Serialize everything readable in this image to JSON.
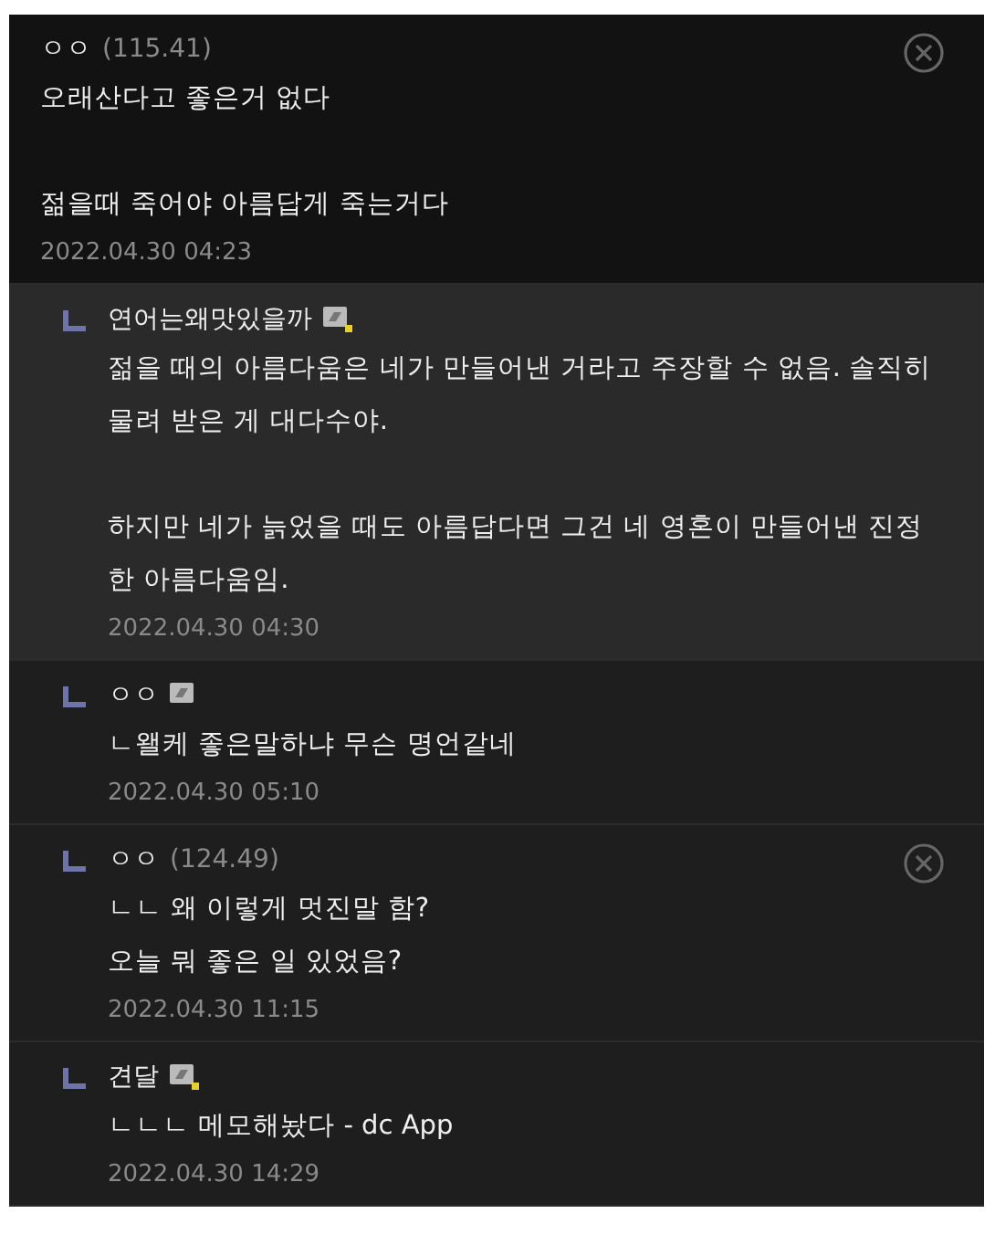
{
  "comments": [
    {
      "kind": "comment",
      "author": "ㅇㅇ",
      "ip": "(115.41)",
      "highlighted": false,
      "deletable": true,
      "text": "오래산다고 좋은거 없다\n\n젊을때 죽어야 아름답게 죽는거다",
      "date": "2022.04.30 04:23"
    },
    {
      "kind": "reply",
      "author": "연어는왜맛있을까",
      "nick_icon": true,
      "fixed_nick": true,
      "highlighted": true,
      "deletable": false,
      "text": "젊을 때의 아름다움은 네가 만들어낸 거라고 주장할 수 없음. 솔직히 물려 받은 게 대다수야.\n\n하지만 네가 늙었을 때도 아름답다면 그건 네 영혼이 만들어낸 진정한 아름다움임.",
      "date": "2022.04.30 04:30"
    },
    {
      "kind": "reply",
      "author": "ㅇㅇ",
      "nick_icon": true,
      "fixed_nick": false,
      "highlighted": false,
      "deletable": false,
      "text": "ㄴ왤케 좋은말하냐 무슨 명언같네",
      "date": "2022.04.30 05:10"
    },
    {
      "kind": "reply",
      "author": "ㅇㅇ",
      "ip": "(124.49)",
      "highlighted": false,
      "deletable": true,
      "text": "ㄴㄴ 왜 이렇게 멋진말 함?\n오늘 뭐 좋은 일 있었음?",
      "date": "2022.04.30 11:15"
    },
    {
      "kind": "reply",
      "author": "견달",
      "nick_icon": true,
      "fixed_nick": true,
      "highlighted": false,
      "deletable": false,
      "text": "ㄴㄴㄴ 메모해놨다 - dc App",
      "date": "2022.04.30 14:29"
    }
  ]
}
